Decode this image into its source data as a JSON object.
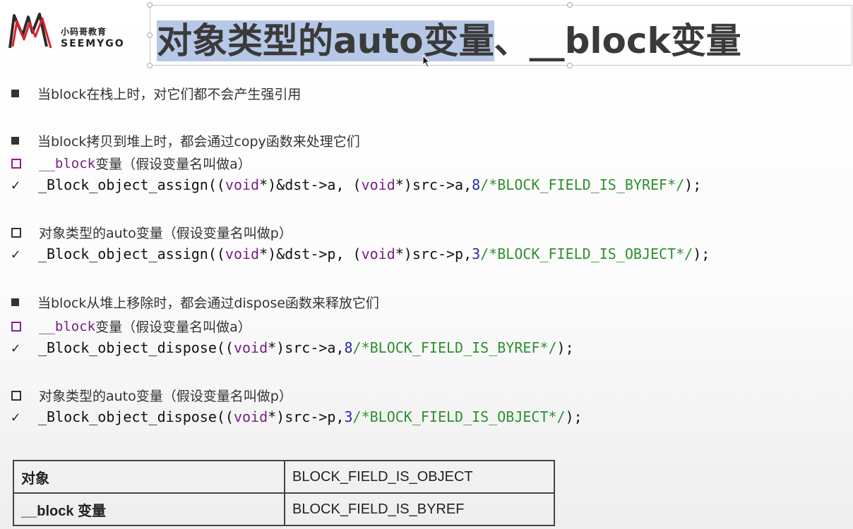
{
  "logo": {
    "cn": "小码哥教育",
    "en": "SEEMYGO"
  },
  "title": {
    "highlighted": "对象类型的auto变量",
    "rest": "、__block变量"
  },
  "lines": {
    "l1": {
      "text": "当block在栈上时，对它们都不会产生强引用"
    },
    "l2": {
      "text": "当block拷贝到堆上时，都会通过copy函数来处理它们"
    },
    "l3": {
      "prefix": "__block",
      "text": "变量（假设变量名叫做a）"
    },
    "l4": {
      "a": "_Block_object_assign((",
      "b": "void",
      "c": "*)&dst->a, (",
      "d": "void",
      "e": "*)src->a, ",
      "f": "8",
      "g": "/*BLOCK_FIELD_IS_BYREF*/",
      "h": ");"
    },
    "l5": {
      "text": "对象类型的auto变量（假设变量名叫做p）"
    },
    "l6": {
      "a": "_Block_object_assign((",
      "b": "void",
      "c": "*)&dst->p, (",
      "d": "void",
      "e": "*)src->p, ",
      "f": "3",
      "g": "/*BLOCK_FIELD_IS_OBJECT*/",
      "h": ");"
    },
    "l7": {
      "text": "当block从堆上移除时，都会通过dispose函数来释放它们"
    },
    "l8": {
      "prefix": "__block",
      "text": "变量（假设变量名叫做a）"
    },
    "l9": {
      "a": "_Block_object_dispose((",
      "b": "void",
      "c": "*)src->a, ",
      "f": "8",
      "g": "/*BLOCK_FIELD_IS_BYREF*/",
      "h": ");"
    },
    "l10": {
      "text": "对象类型的auto变量（假设变量名叫做p）"
    },
    "l11": {
      "a": "_Block_object_dispose((",
      "b": "void",
      "c": "*)src->p, ",
      "f": "3",
      "g": "/*BLOCK_FIELD_IS_OBJECT*/",
      "h": ");"
    }
  },
  "check_mark": "✓",
  "table": [
    {
      "type": "对象",
      "flag": "BLOCK_FIELD_IS_OBJECT"
    },
    {
      "type": "__block 变量",
      "flag": "BLOCK_FIELD_IS_BYREF"
    }
  ]
}
